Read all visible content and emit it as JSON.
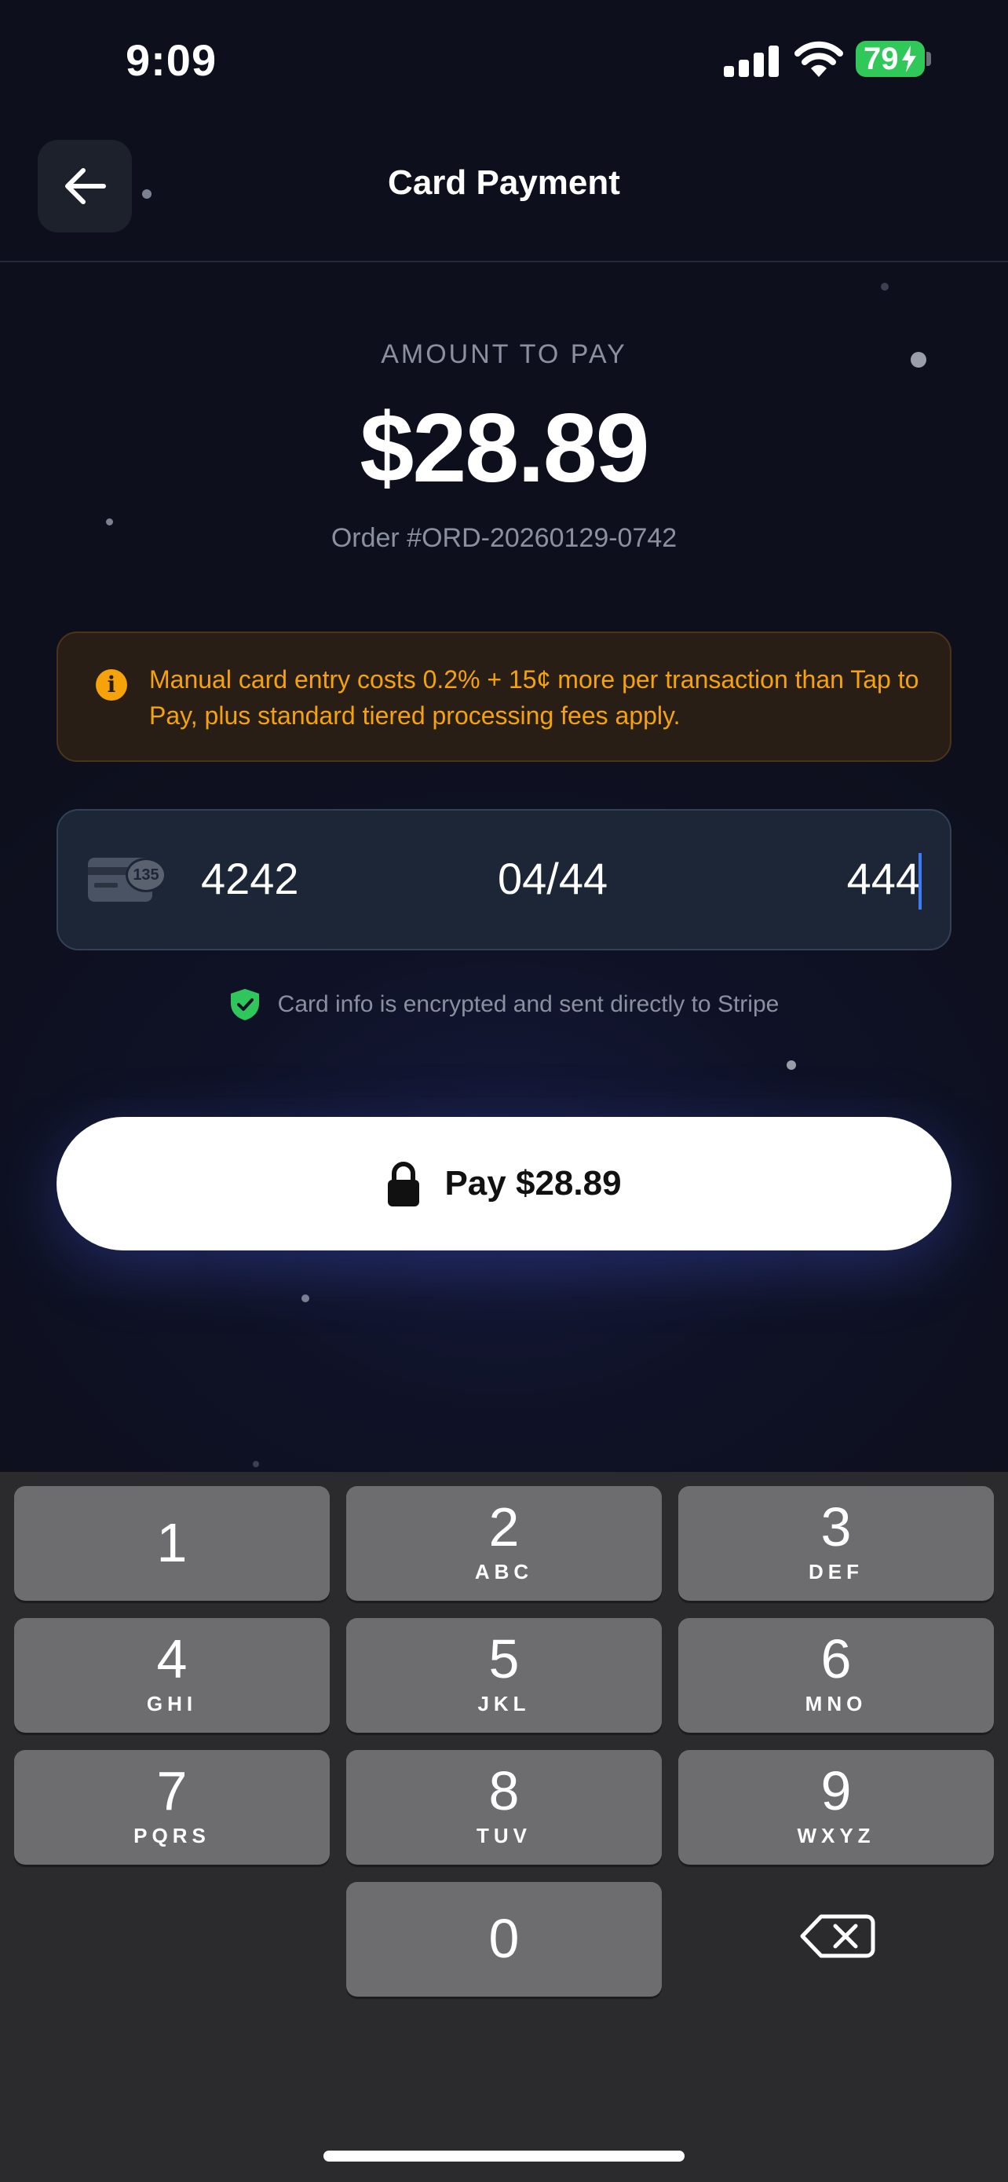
{
  "status_bar": {
    "time": "9:09",
    "battery": "79"
  },
  "header": {
    "title": "Card Payment"
  },
  "amount": {
    "label": "AMOUNT TO PAY",
    "value": "$28.89",
    "order": "Order #ORD-20260129-0742"
  },
  "notice": {
    "text": "Manual card entry costs 0.2% + 15¢ more per transaction than Tap to Pay, plus standard tiered processing fees apply.",
    "icon": "info-icon",
    "color": "#f5a20b"
  },
  "card": {
    "number": "4242",
    "expiry": "04/44",
    "cvc": "444",
    "badge": "135"
  },
  "security": {
    "text": "Card info is encrypted and sent directly to Stripe"
  },
  "pay_button": {
    "label": "Pay $28.89"
  },
  "keyboard": {
    "keys": [
      {
        "digit": "1",
        "letters": ""
      },
      {
        "digit": "2",
        "letters": "ABC"
      },
      {
        "digit": "3",
        "letters": "DEF"
      },
      {
        "digit": "4",
        "letters": "GHI"
      },
      {
        "digit": "5",
        "letters": "JKL"
      },
      {
        "digit": "6",
        "letters": "MNO"
      },
      {
        "digit": "7",
        "letters": "PQRS"
      },
      {
        "digit": "8",
        "letters": "TUV"
      },
      {
        "digit": "9",
        "letters": "WXYZ"
      },
      {
        "digit": "0",
        "letters": ""
      }
    ]
  }
}
